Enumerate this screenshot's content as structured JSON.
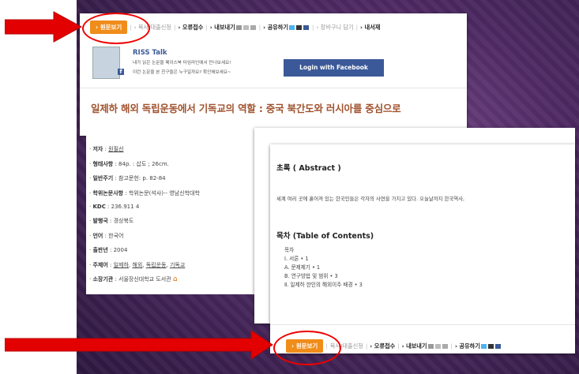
{
  "toolbar_top": {
    "fulltext_btn": "› 원문보기",
    "copy_loan": "› 복사/대출신청",
    "error_report": "› 오류접수",
    "export": "› 내보내기",
    "share": "› 공유하기",
    "cart": "› 장바구니 담기",
    "library": "› 내서재"
  },
  "riss_talk": {
    "title": "RISS Talk",
    "line1": "내가 읽은 논문을 페이스북 타임라인에서 만나보세요!",
    "line2": "이런 논문을 본 친구들은 누구일까요? 확인해보세요~",
    "login_btn": "Login with Facebook"
  },
  "paper": {
    "title": "일제하 해외 독립운동에서 기독교의 역할 : 중국 북간도와 러시아를 중심으로",
    "meta": {
      "author_label": "저자",
      "author": "원필선",
      "form_label": "형태사항",
      "form": "84p. : 삽도 ; 26cm.",
      "note_label": "일반주기",
      "note": "참고문헌: p. 82-84",
      "degree_label": "학위논문사항",
      "degree": "학위논문(석사)-- 영남신학대학",
      "kdc_label": "KDC",
      "kdc": "236.911 4",
      "country_label": "발행국",
      "country": "경상북도",
      "lang_label": "언어",
      "lang": "한국어",
      "year_label": "출판년",
      "year": "2004",
      "subject_label": "주제어",
      "subjects": [
        "일제하",
        "해외",
        "독립운동",
        "기독교"
      ],
      "holder_label": "소장기관",
      "holder": "서울장신대학교 도서관"
    }
  },
  "abstract": {
    "heading": "초록 ( Abstract )",
    "text": "세계 여러 곳에 흩어져 있는 한국인들은 각자의 사연을 가지고 있다. 오늘날까지 한국역사,"
  },
  "toc": {
    "heading": "목차 (Table of Contents)",
    "items": [
      "목차",
      "Ⅰ. 서론 • 1",
      "A. 문제제기 • 1",
      "B. 연구방법 및 범위 • 3",
      "Ⅱ. 일제하 한인의 해외이주 배경 • 3"
    ]
  },
  "toolbar_bottom": {
    "fulltext_btn": "› 원문보기",
    "copy_loan": "복사/대출신청",
    "error_report": "› 오류접수",
    "export": "› 내보내기",
    "share": "› 공유하기"
  },
  "colors": {
    "accent": "#f08c1a",
    "arrow": "#e30000",
    "facebook": "#3b5998",
    "title": "#a0522d"
  }
}
